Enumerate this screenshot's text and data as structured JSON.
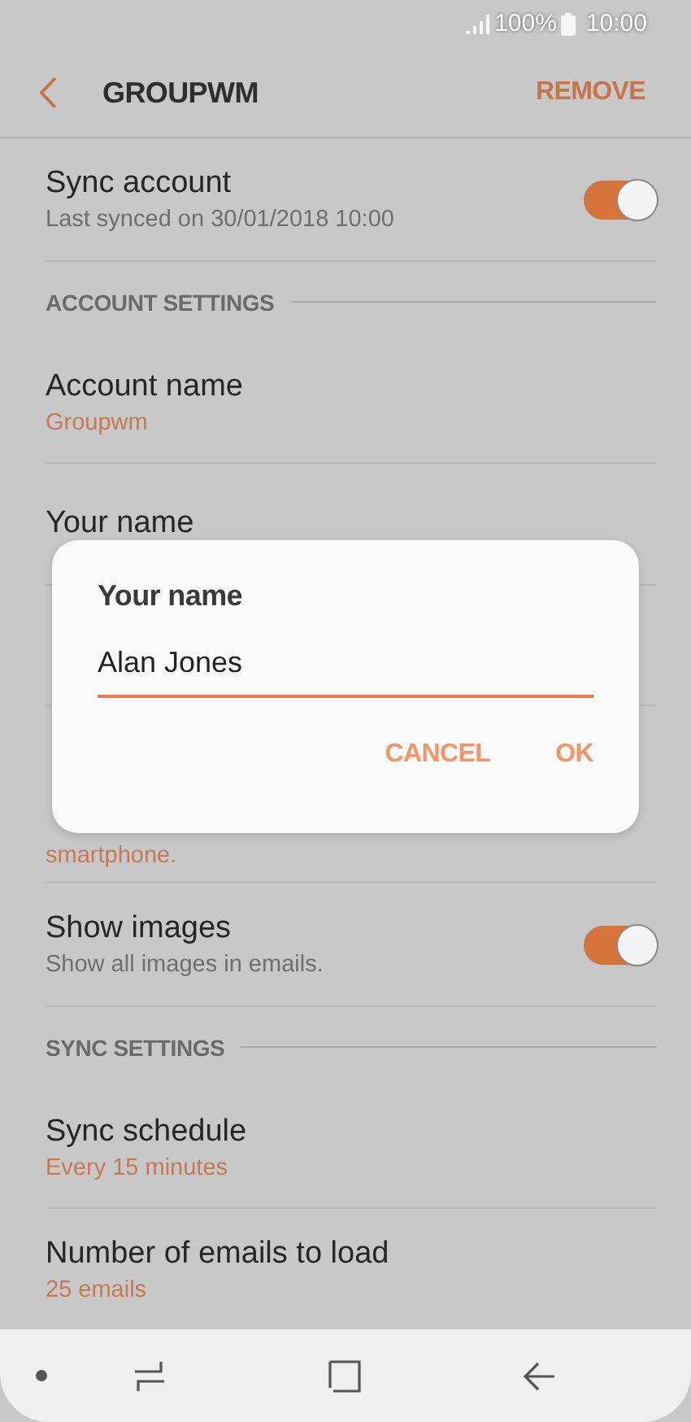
{
  "status_bar": {
    "battery": "100%",
    "time": "10:00"
  },
  "header": {
    "title": "GROUPWM",
    "action": "REMOVE"
  },
  "items": [
    {
      "kind": "toggle",
      "title": "Sync account",
      "subtitle": "Last synced on 30/01/2018  10:00",
      "on": true
    },
    {
      "kind": "section",
      "title": "ACCOUNT SETTINGS"
    },
    {
      "kind": "value",
      "title": "Account name",
      "subtitle": "Groupwm"
    },
    {
      "kind": "value",
      "title": "Your name"
    },
    {
      "kind": "value"
    },
    {
      "kind": "tall",
      "subtitle": "smartphone."
    },
    {
      "kind": "toggle",
      "title": "Show images",
      "subtitle": "Show all images in emails.",
      "on": true
    },
    {
      "kind": "section",
      "title": "SYNC SETTINGS"
    },
    {
      "kind": "value",
      "title": "Sync schedule",
      "subtitle": "Every 15 minutes"
    },
    {
      "kind": "value",
      "title": "Number of emails to load",
      "subtitle": "25 emails"
    }
  ],
  "dialog": {
    "title": "Your name",
    "value": "Alan Jones",
    "buttons": [
      "CANCEL",
      "OK"
    ]
  }
}
